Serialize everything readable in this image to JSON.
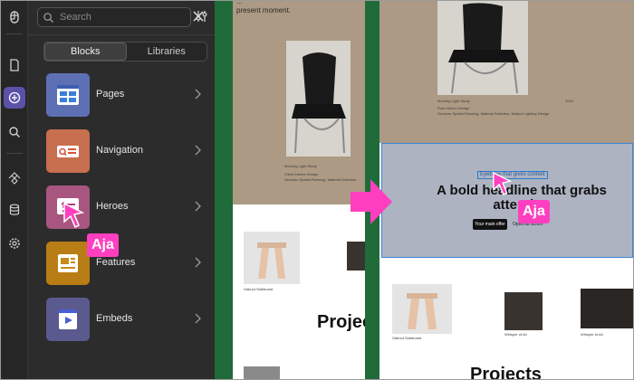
{
  "colors": {
    "panel_bg": "#2c2c2c",
    "rail_bg": "#262626",
    "accent": "#5a52a8",
    "cursor_tag": "#ff3fbf",
    "green_divider": "#1f6b3a",
    "hero_bg": "#ad9a84",
    "selected_section_bg": "#aeb3c2",
    "selection_outline": "#3a86d8"
  },
  "rail": {
    "icons": [
      "figma-logo-icon",
      "page-icon",
      "insert-icon",
      "search-icon",
      "components-icon",
      "database-icon",
      "settings-icon"
    ],
    "active": "insert-icon"
  },
  "panel": {
    "search_placeholder": "Search",
    "tabs": [
      {
        "label": "Blocks",
        "selected": true
      },
      {
        "label": "Libraries",
        "selected": false
      }
    ],
    "items": [
      {
        "label": "Pages",
        "color": "#5e70b4",
        "icon": "pages-icon"
      },
      {
        "label": "Navigation",
        "color": "#c76f4e",
        "icon": "navigation-icon"
      },
      {
        "label": "Heroes",
        "color": "#a8567f",
        "icon": "heroes-icon"
      },
      {
        "label": "Features",
        "color": "#b87d14",
        "icon": "features-icon"
      },
      {
        "label": "Embeds",
        "color": "#5a5a8e",
        "icon": "embeds-icon"
      }
    ]
  },
  "cursor_tag": "Aja",
  "preview1": {
    "top_text_line1": "...",
    "top_text_line2": "present moment.",
    "meta_title": "Morning Light Study",
    "meta_rows": [
      "Client   Interior Design",
      "Services   Spatial Planning, Material Selection"
    ],
    "projects_heading": "Projec",
    "caption_stool": "Oaknut Sideboard"
  },
  "preview2": {
    "meta_title": "Morning Light Study",
    "meta_year": "2024",
    "meta_rows": [
      "Role   Interior Design",
      "Services   Spatial Planning, Material Selection, Natural Lighting Design"
    ],
    "eyebrow": "Eyebrow that gives context",
    "headline": "A bold headline that grabs attention",
    "primary_button": "Your main offer",
    "secondary_button": "Optional action",
    "projects_heading": "Projects",
    "captions": [
      "Oaknut Sideboard",
      "Whisper of Air",
      "Whisper of Air"
    ]
  }
}
